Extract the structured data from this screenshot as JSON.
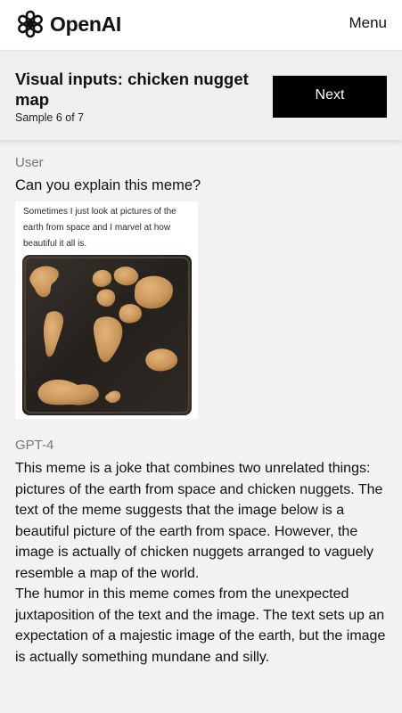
{
  "brand": {
    "name": "OpenAI"
  },
  "nav": {
    "menu_label": "Menu"
  },
  "sample": {
    "title": "Visual inputs: chicken nugget map",
    "counter": "Sample 6 of 7",
    "next_label": "Next"
  },
  "conversation": {
    "user": {
      "role": "User",
      "message": "Can you explain this meme?",
      "image": {
        "caption": "Sometimes I just look at pictures of the earth from space and I marvel at how beautiful it all is."
      }
    },
    "assistant": {
      "role": "GPT-4",
      "paragraphs": [
        "This meme is a joke that combines two unrelated things: pictures of the earth from space and chicken nuggets. The text of the meme suggests that the image below is a beautiful picture of the earth from space. However, the image is actually of chicken nuggets arranged to vaguely resemble a map of the world.",
        "The humor in this meme comes from the unexpected juxtaposition of the text and the image. The text sets up an expectation of a majestic image of the earth, but the image is actually something mundane and silly."
      ]
    }
  },
  "colors": {
    "background": "#f2f2f2",
    "topbar": "#ffffff",
    "button": "#000000",
    "role_label": "#777777",
    "nugget": "#c9955a",
    "tray": "#2b2622"
  },
  "icons": [
    "openai-logo-icon"
  ]
}
